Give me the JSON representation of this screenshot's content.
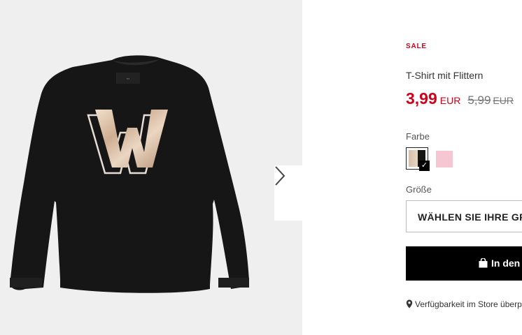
{
  "gallery": {
    "product_image": "black-long-sleeve-tshirt-sequin-w",
    "next_icon": "chevron-right-icon"
  },
  "product": {
    "badge": "SALE",
    "title": "T-Shirt mit Flittern",
    "price_current": "3,99",
    "price_current_currency": "EUR",
    "price_old": "5,99",
    "price_old_currency": "EUR"
  },
  "color": {
    "label": "Farbe",
    "options": [
      {
        "name": "black-sequin",
        "selected": true,
        "color": "#151515"
      },
      {
        "name": "pink",
        "selected": false,
        "color": "#f6c7d2"
      }
    ]
  },
  "size": {
    "label": "Größe",
    "select_value": "WÄHLEN SIE IHRE GRÖSSE"
  },
  "cart": {
    "label": "In den Warenkorb",
    "icon": "shopping-bag-icon"
  },
  "store": {
    "icon": "map-pin-icon",
    "label": "Verfügbarkeit im Store überprüfen"
  },
  "colors": {
    "sale": "#d0021b",
    "button": "#000000",
    "image_bg": "#efefef"
  }
}
